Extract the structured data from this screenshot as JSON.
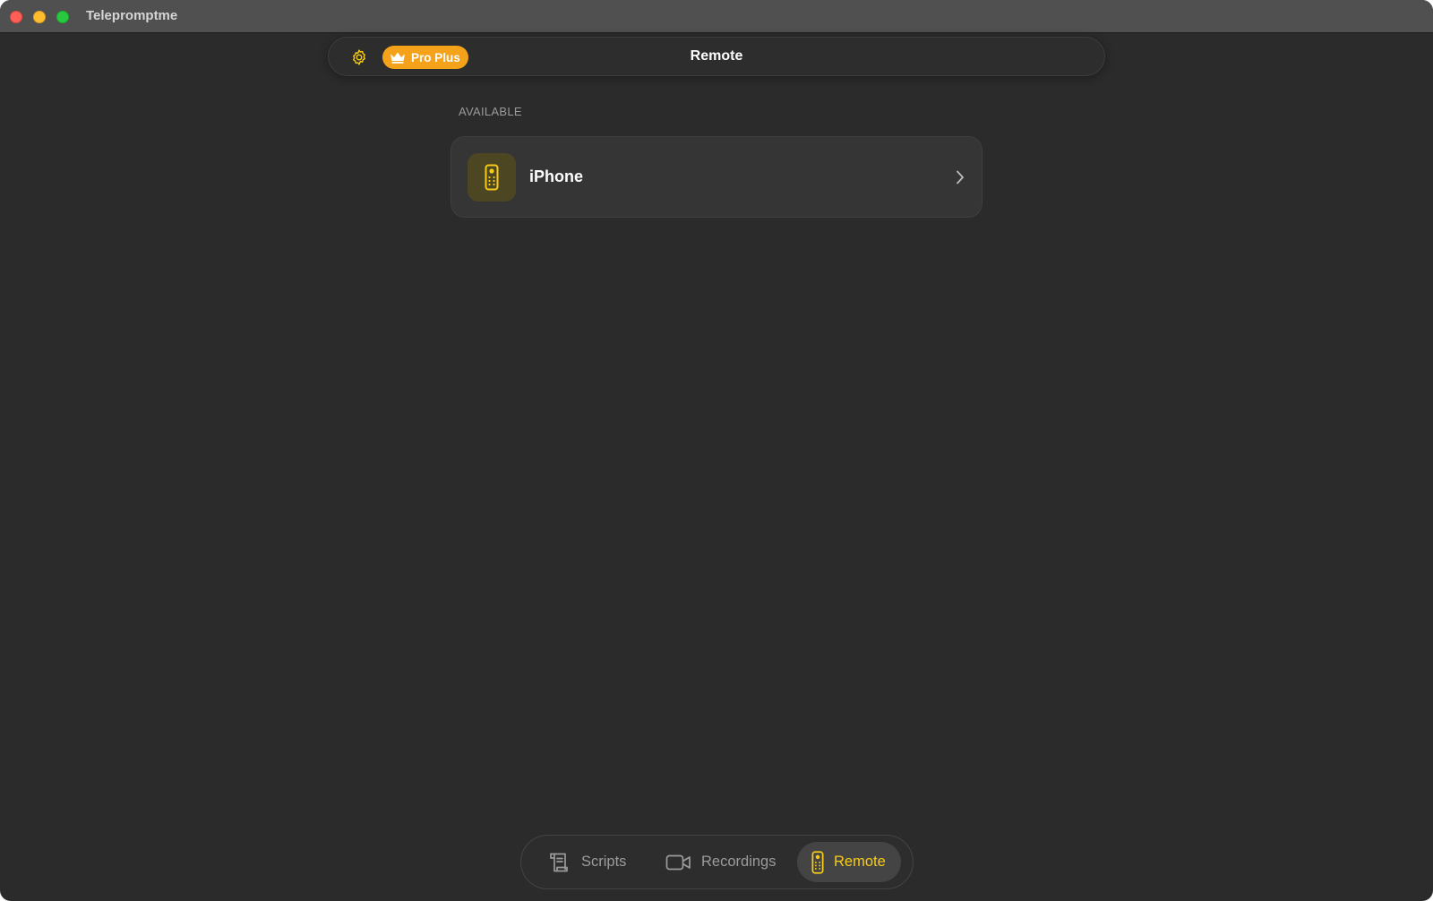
{
  "window": {
    "app_title": "Telepromptme"
  },
  "toolbar": {
    "title": "Remote",
    "pro_badge_label": "Pro Plus",
    "pro_badge_color": "#f5a21b",
    "settings_icon": "gear-icon"
  },
  "section": {
    "header": "AVAILABLE"
  },
  "devices": [
    {
      "name": "iPhone",
      "icon": "remote-control-icon"
    }
  ],
  "tabbar": {
    "tabs": [
      {
        "label": "Scripts",
        "icon": "scroll-icon",
        "selected": false
      },
      {
        "label": "Recordings",
        "icon": "video-camera-icon",
        "selected": false
      },
      {
        "label": "Remote",
        "icon": "remote-control-icon",
        "selected": true
      }
    ]
  },
  "colors": {
    "accent": "#f7cb16",
    "background": "#2b2b2b"
  }
}
